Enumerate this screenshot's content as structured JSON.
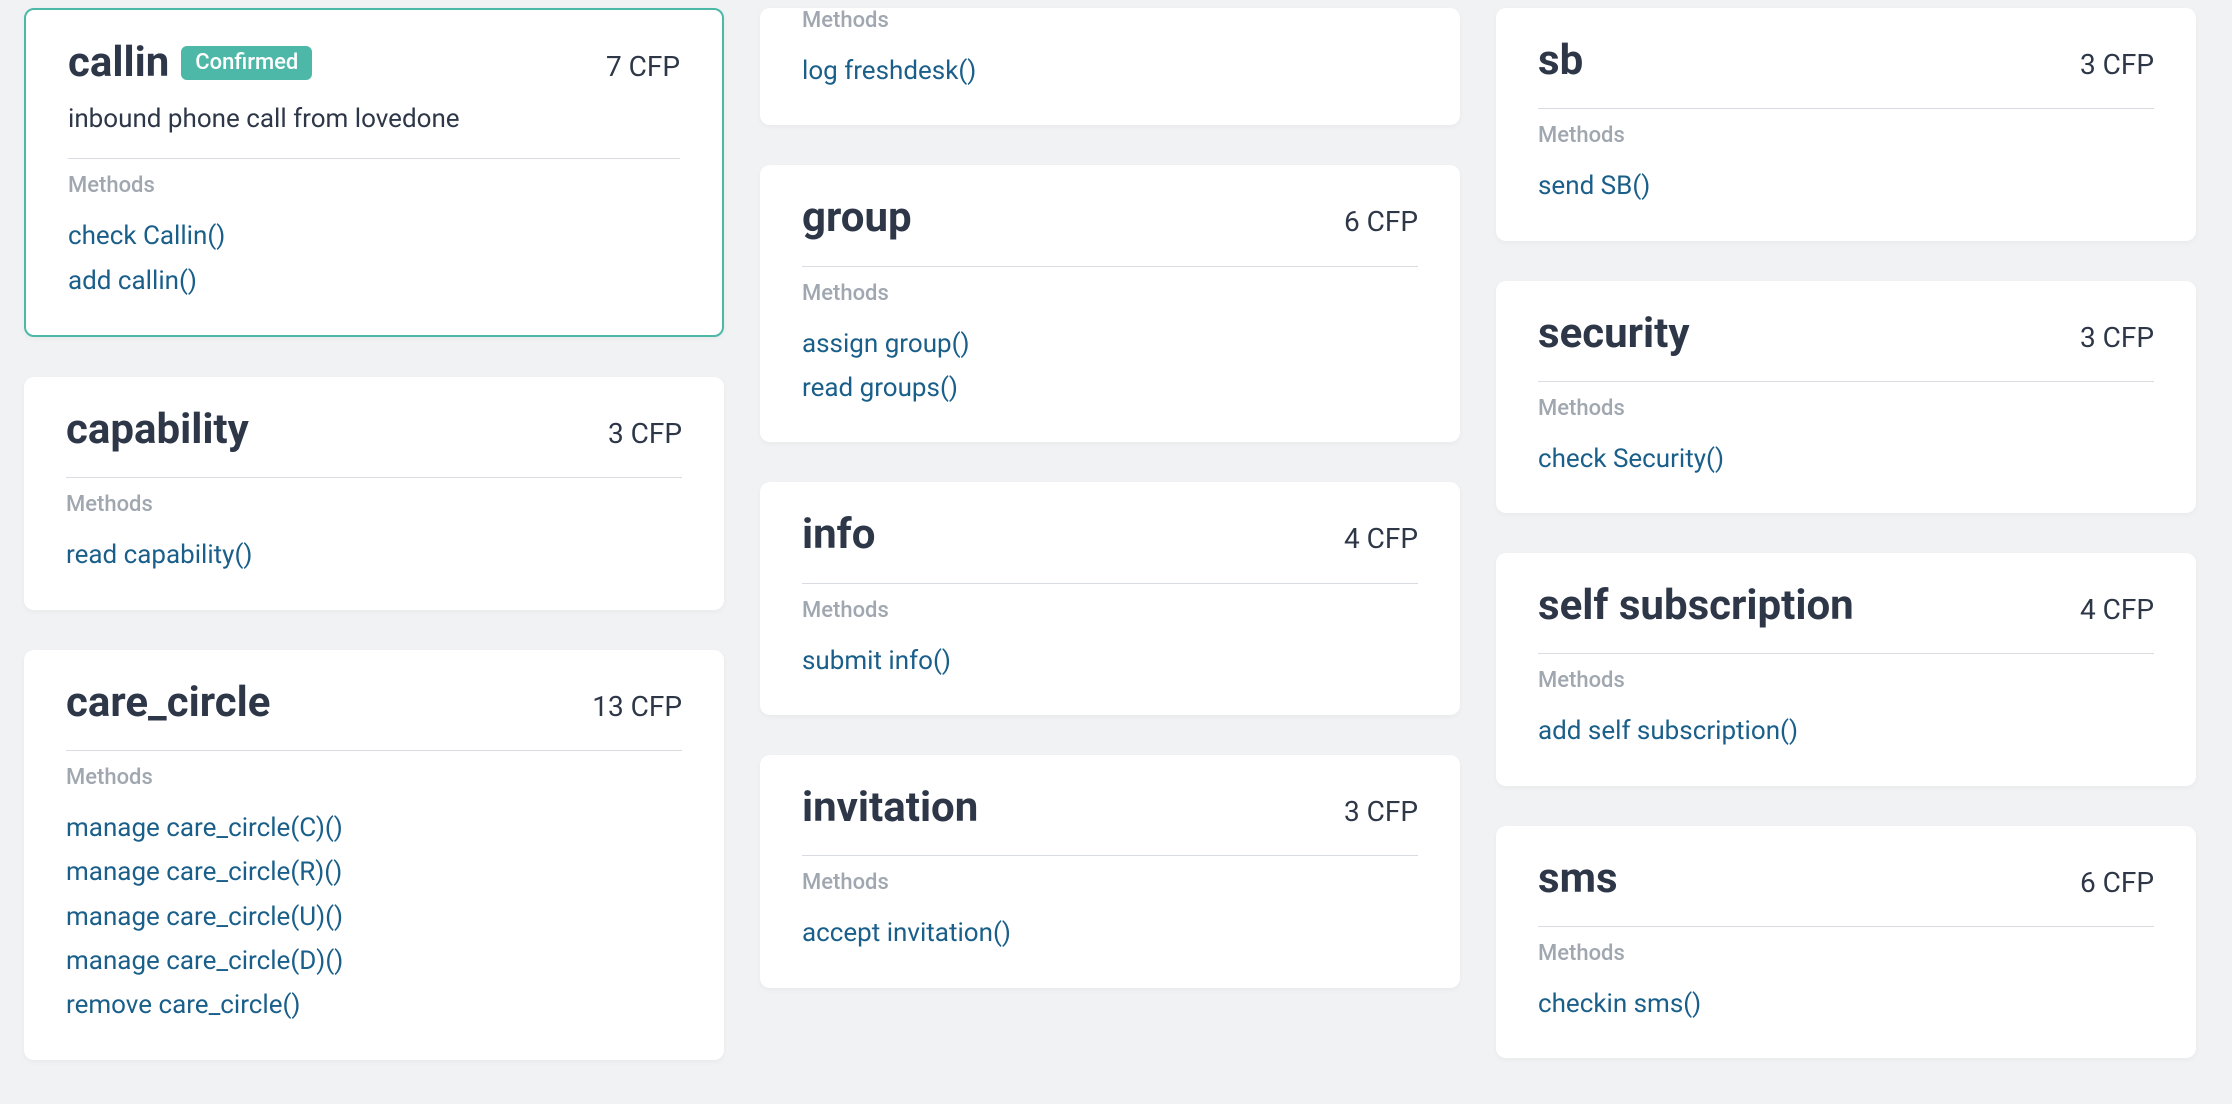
{
  "labels": {
    "methods": "Methods",
    "cfp_suffix": "CFP"
  },
  "columns": [
    {
      "id": "col1",
      "cards": [
        {
          "id": "callin",
          "title": "callin",
          "badge": "Confirmed",
          "cfp": "7 CFP",
          "description": "inbound phone call from lovedone",
          "selected": true,
          "methods": [
            "check Callin()",
            "add callin()"
          ]
        },
        {
          "id": "capability",
          "title": "capability",
          "cfp": "3 CFP",
          "methods": [
            "read capability()"
          ]
        },
        {
          "id": "care_circle",
          "title": "care_circle",
          "cfp": "13 CFP",
          "methods": [
            "manage care_circle(C)()",
            "manage care_circle(R)()",
            "manage care_circle(U)()",
            "manage care_circle(D)()",
            "remove care_circle()"
          ]
        }
      ]
    },
    {
      "id": "col2",
      "cards": [
        {
          "id": "freshdesk",
          "partialTop": true,
          "methods": [
            "log freshdesk()"
          ]
        },
        {
          "id": "group",
          "title": "group",
          "cfp": "6 CFP",
          "methods": [
            "assign group()",
            "read groups()"
          ]
        },
        {
          "id": "info",
          "title": "info",
          "cfp": "4 CFP",
          "methods": [
            "submit info()"
          ]
        },
        {
          "id": "invitation",
          "title": "invitation",
          "cfp": "3 CFP",
          "methods": [
            "accept invitation()"
          ]
        }
      ]
    },
    {
      "id": "col3",
      "cards": [
        {
          "id": "sb",
          "title": "sb",
          "cfp": "3 CFP",
          "partialHeader": true,
          "methods": [
            "send SB()"
          ]
        },
        {
          "id": "security",
          "title": "security",
          "cfp": "3 CFP",
          "methods": [
            "check Security()"
          ]
        },
        {
          "id": "self_subscription",
          "title": "self subscription",
          "cfp": "4 CFP",
          "methods": [
            "add self subscription()"
          ]
        },
        {
          "id": "sms",
          "title": "sms",
          "cfp": "6 CFP",
          "methods": [
            "checkin sms()"
          ]
        }
      ]
    }
  ]
}
